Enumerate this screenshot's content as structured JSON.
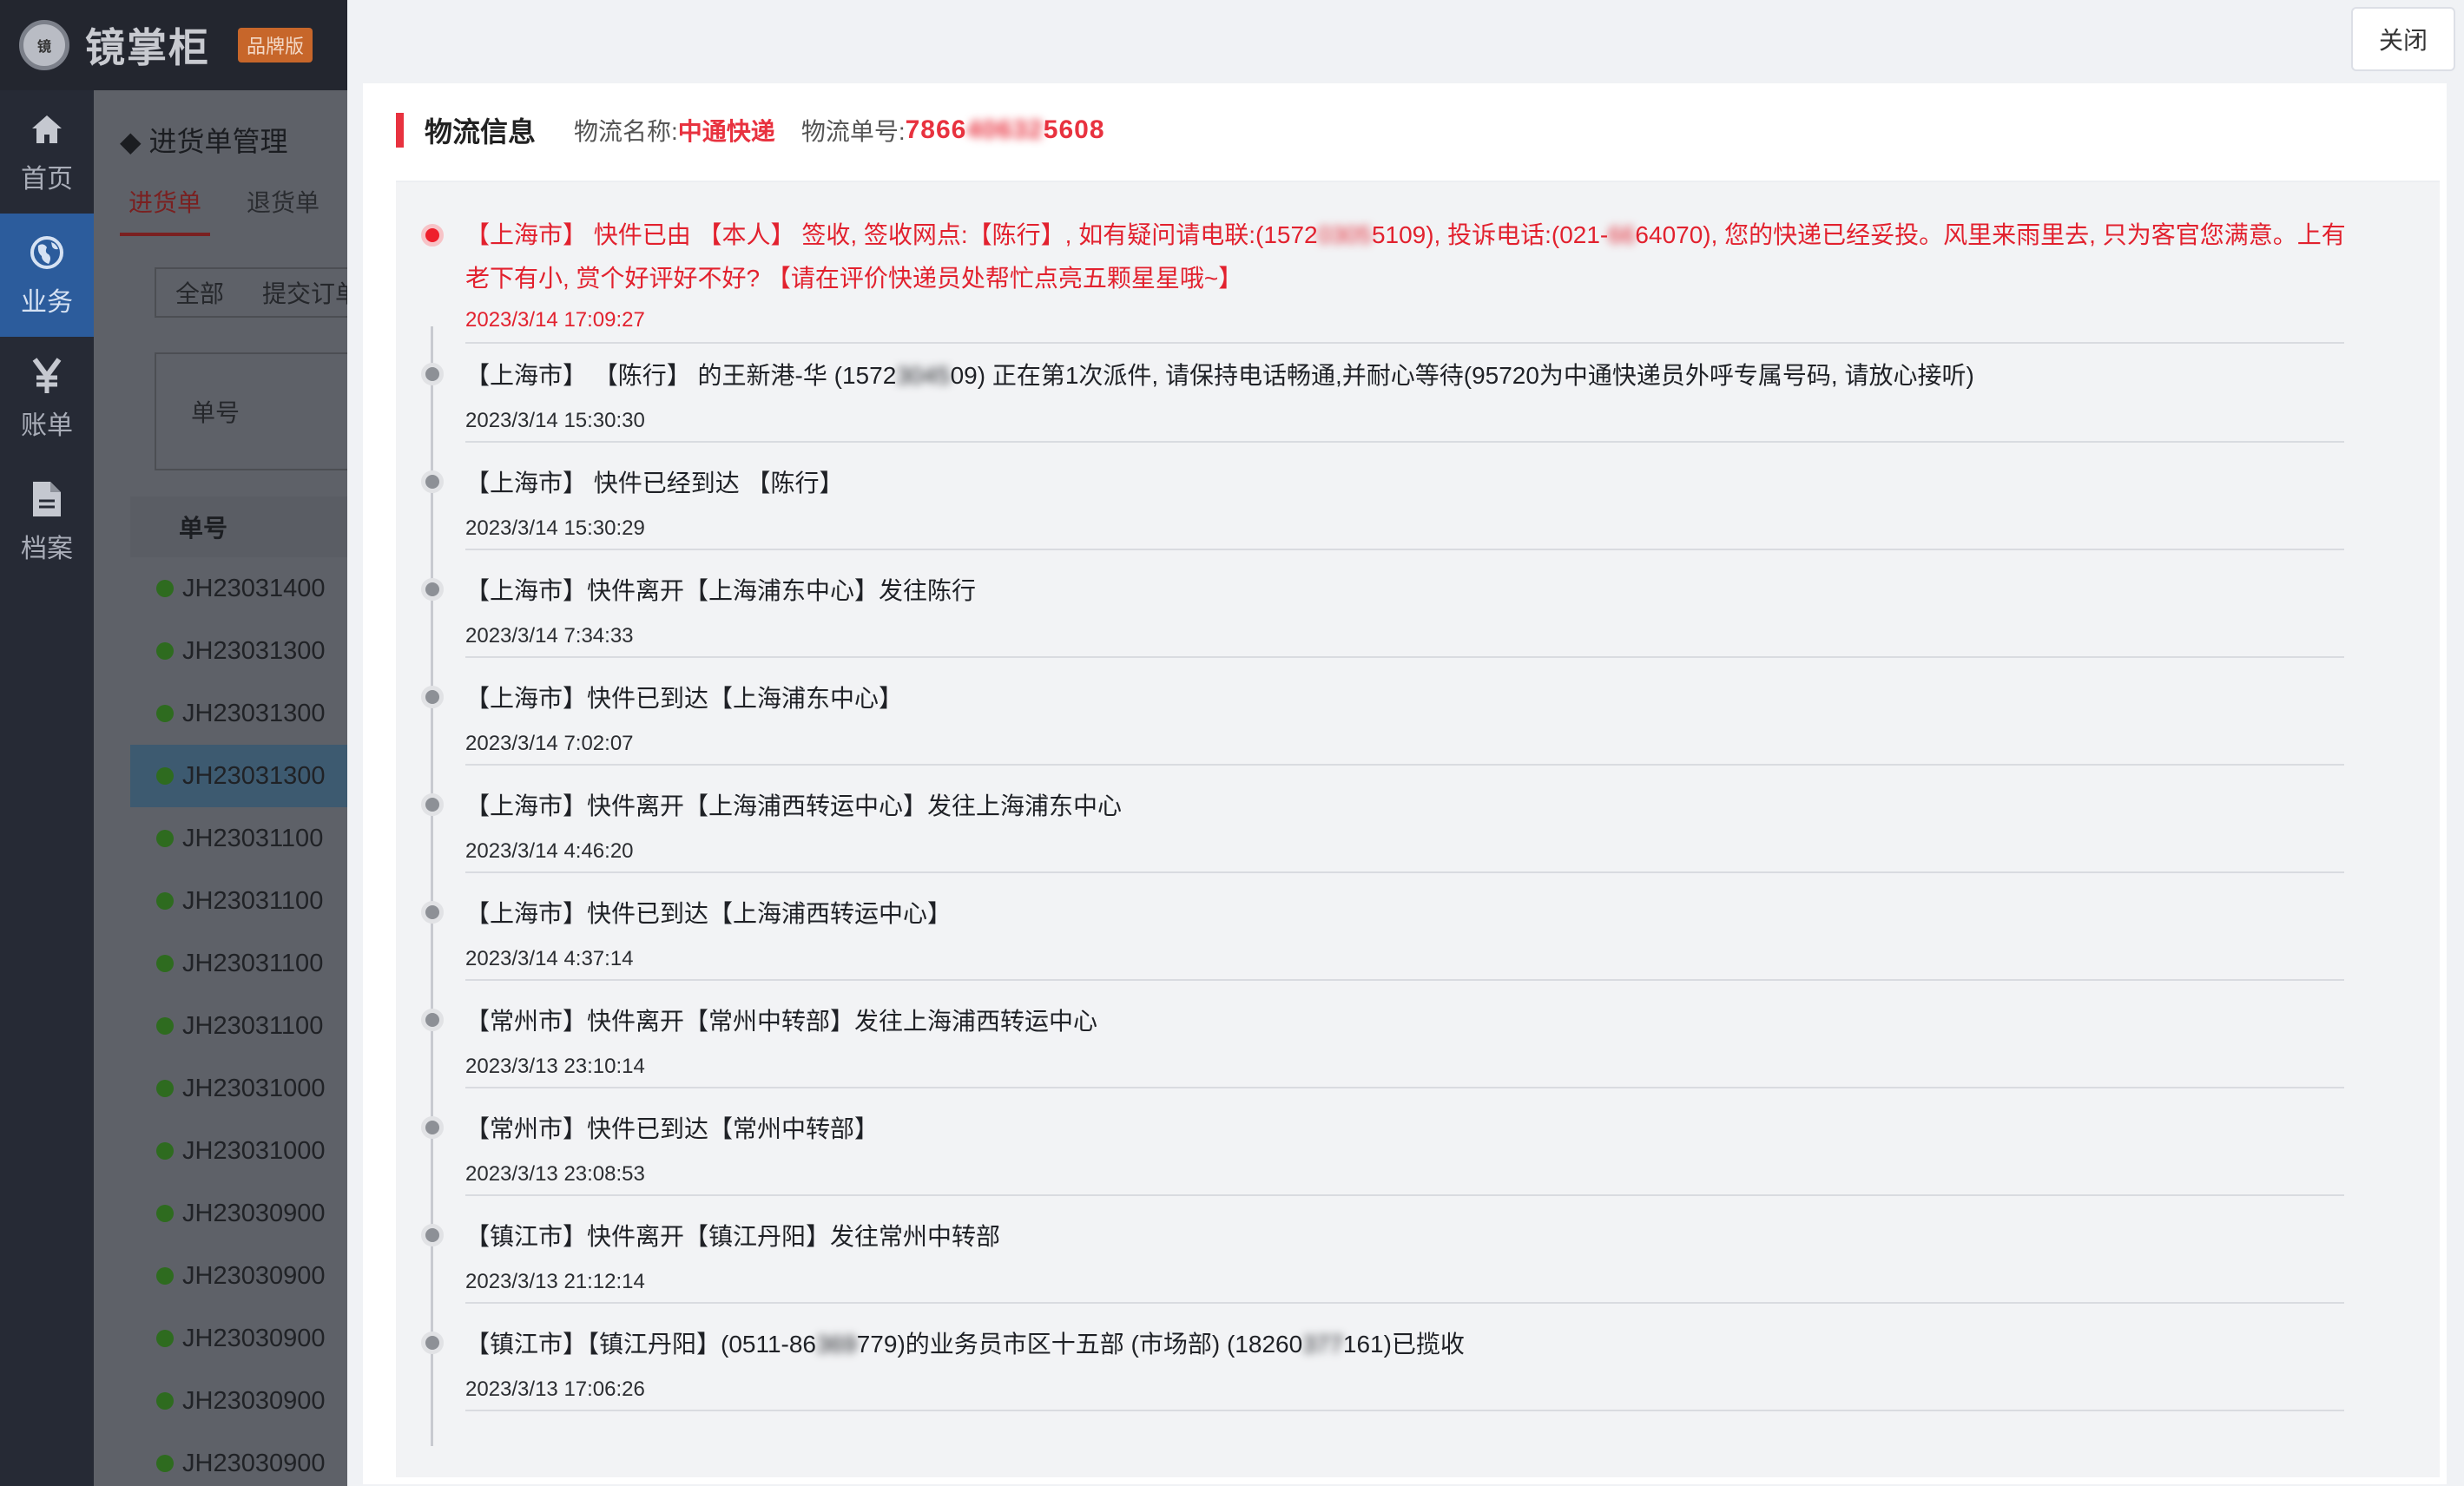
{
  "app": {
    "name": "镜掌柜",
    "edition": "品牌版",
    "logo_text": "镜"
  },
  "sidebar": {
    "items": [
      {
        "label": "首页",
        "icon": "home-icon"
      },
      {
        "label": "业务",
        "icon": "globe-icon",
        "active": true
      },
      {
        "label": "账单",
        "icon": "yen-icon"
      },
      {
        "label": "档案",
        "icon": "document-icon"
      }
    ]
  },
  "background_page": {
    "title": "进货单管理",
    "tabs": [
      "进货单",
      "退货单"
    ],
    "filter_tabs": [
      "全部",
      "提交订单"
    ],
    "search_label": "单号",
    "table_header": "单号",
    "rows": [
      "JH23031400",
      "JH23031300",
      "JH23031300",
      "JH23031300",
      "JH23031100",
      "JH23031100",
      "JH23031100",
      "JH23031100",
      "JH23031000",
      "JH23031000",
      "JH23030900",
      "JH23030900",
      "JH23030900",
      "JH23030900",
      "JH23030900"
    ],
    "selected_row_index": 3
  },
  "drawer": {
    "close_label": "关闭",
    "section_title": "物流信息",
    "carrier_label": "物流名称:",
    "carrier_value": "中通快递",
    "tracking_label": "物流单号:",
    "tracking_prefix": "7866",
    "tracking_masked": "40632",
    "tracking_suffix": "5608"
  },
  "timeline": [
    {
      "active": true,
      "text_parts": [
        "【上海市】 快件已由 【本人】 签收, 签收网点:【陈行】, 如有疑问请电联:(1572",
        "0305",
        "5109), 投诉电话:(021-",
        "66",
        "64070), 您的快递已经妥投。风里来雨里去, 只为客官您满意。上有老下有小, 赏个好评好不好? 【请在评价快递员处帮忙点亮五颗星星哦~】"
      ],
      "time": "2023/3/14 17:09:27"
    },
    {
      "text_parts": [
        "【上海市】 【陈行】 的王新港-华 (1572",
        "3045",
        "09) 正在第1次派件, 请保持电话畅通,并耐心等待(95720为中通快递员外呼专属号码, 请放心接听)"
      ],
      "time": "2023/3/14 15:30:30"
    },
    {
      "text_parts": [
        "【上海市】 快件已经到达 【陈行】"
      ],
      "time": "2023/3/14 15:30:29"
    },
    {
      "text_parts": [
        "【上海市】快件离开【上海浦东中心】发往陈行"
      ],
      "time": "2023/3/14 7:34:33"
    },
    {
      "text_parts": [
        "【上海市】快件已到达【上海浦东中心】"
      ],
      "time": "2023/3/14 7:02:07"
    },
    {
      "text_parts": [
        "【上海市】快件离开【上海浦西转运中心】发往上海浦东中心"
      ],
      "time": "2023/3/14 4:46:20"
    },
    {
      "text_parts": [
        "【上海市】快件已到达【上海浦西转运中心】"
      ],
      "time": "2023/3/14 4:37:14"
    },
    {
      "text_parts": [
        "【常州市】快件离开【常州中转部】发往上海浦西转运中心"
      ],
      "time": "2023/3/13 23:10:14"
    },
    {
      "text_parts": [
        "【常州市】快件已到达【常州中转部】"
      ],
      "time": "2023/3/13 23:08:53"
    },
    {
      "text_parts": [
        "【镇江市】快件离开【镇江丹阳】发往常州中转部"
      ],
      "time": "2023/3/13 21:12:14"
    },
    {
      "text_parts": [
        "【镇江市】【镇江丹阳】(0511-86",
        "369",
        "779)的业务员市区十五部 (市场部) (18260",
        "377",
        "161)已揽收"
      ],
      "time": "2023/3/13 17:06:26"
    }
  ],
  "colors": {
    "accent_red": "#e8323f",
    "sidebar_active": "#2c5c9c",
    "status_dot_green": "#2e6b1f"
  }
}
